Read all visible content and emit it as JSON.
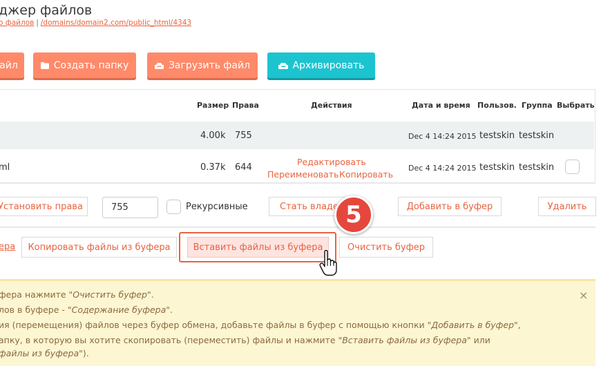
{
  "header": {
    "title": "джер файлов",
    "breadcrumb_first": "о файлов",
    "breadcrumb_sep": "|",
    "breadcrumb_path": "/domains/domain2.com/public_html/4343"
  },
  "toolbar": {
    "btn_file": "айл",
    "btn_create_folder": "Создать папку",
    "btn_upload": "Загрузить файл",
    "btn_archive": "Архивировать"
  },
  "table": {
    "headers": {
      "size": "Размер",
      "perms": "Права",
      "actions": "Действия",
      "datetime": "Дата и время",
      "user": "Пользов.",
      "group": "Группа",
      "select": "Выбрать"
    },
    "rows": [
      {
        "name": "",
        "size": "4.00k",
        "perms": "755",
        "date": "Dec 4 14:24 2015",
        "user": "testskin",
        "group": "testskin"
      },
      {
        "name": "ml",
        "size": "0.37k",
        "perms": "644",
        "date": "Dec 4 14:24 2015",
        "user": "testskin",
        "group": "testskin",
        "action_edit": "Редактировать",
        "action_rename": "Переименовать",
        "action_copy": "Копировать"
      }
    ]
  },
  "bulk": {
    "set_perms": "Установить права",
    "perms_value": "755",
    "recursive": "Рекурсивные",
    "set_owner": "Стать владел",
    "add_to_buffer": "Добавить в буфер",
    "delete": "Удалить"
  },
  "buffer": {
    "link_partial": "ера",
    "copy_from_buffer": "Копировать файлы из буфера",
    "paste_from_buffer": "Вставить файлы из буфера",
    "clear_buffer": "Очистить буфер"
  },
  "step_badge": "5",
  "info": {
    "l1_a": "фера нажмите \"",
    "l1_i": "Очистить буфер",
    "l1_b": "\".",
    "l2_a": "лов в буфере - \"",
    "l2_i": "Содержание буфера",
    "l2_b": "\".",
    "l3_a": "ия (перемещения) файлов через буфер обмена, добавьте файлы в буфер с помощью кнопки \"",
    "l3_i": "Добавить в буфер",
    "l3_b": "\",",
    "l4_a": "апку, в которую вы хотите скопировать (переместить) файлы и нажмите \"",
    "l4_i": "Вставить файлы из буфера",
    "l4_b": "\" или",
    "l5_i": "файлы из буфера",
    "l5_b": "\").",
    "close": "×"
  },
  "colors": {
    "accent": "#fe8a6a",
    "teal": "#1cc4d0",
    "link": "#e8633f",
    "badge": "#e5473c",
    "info_bg": "#fdf6d3"
  }
}
